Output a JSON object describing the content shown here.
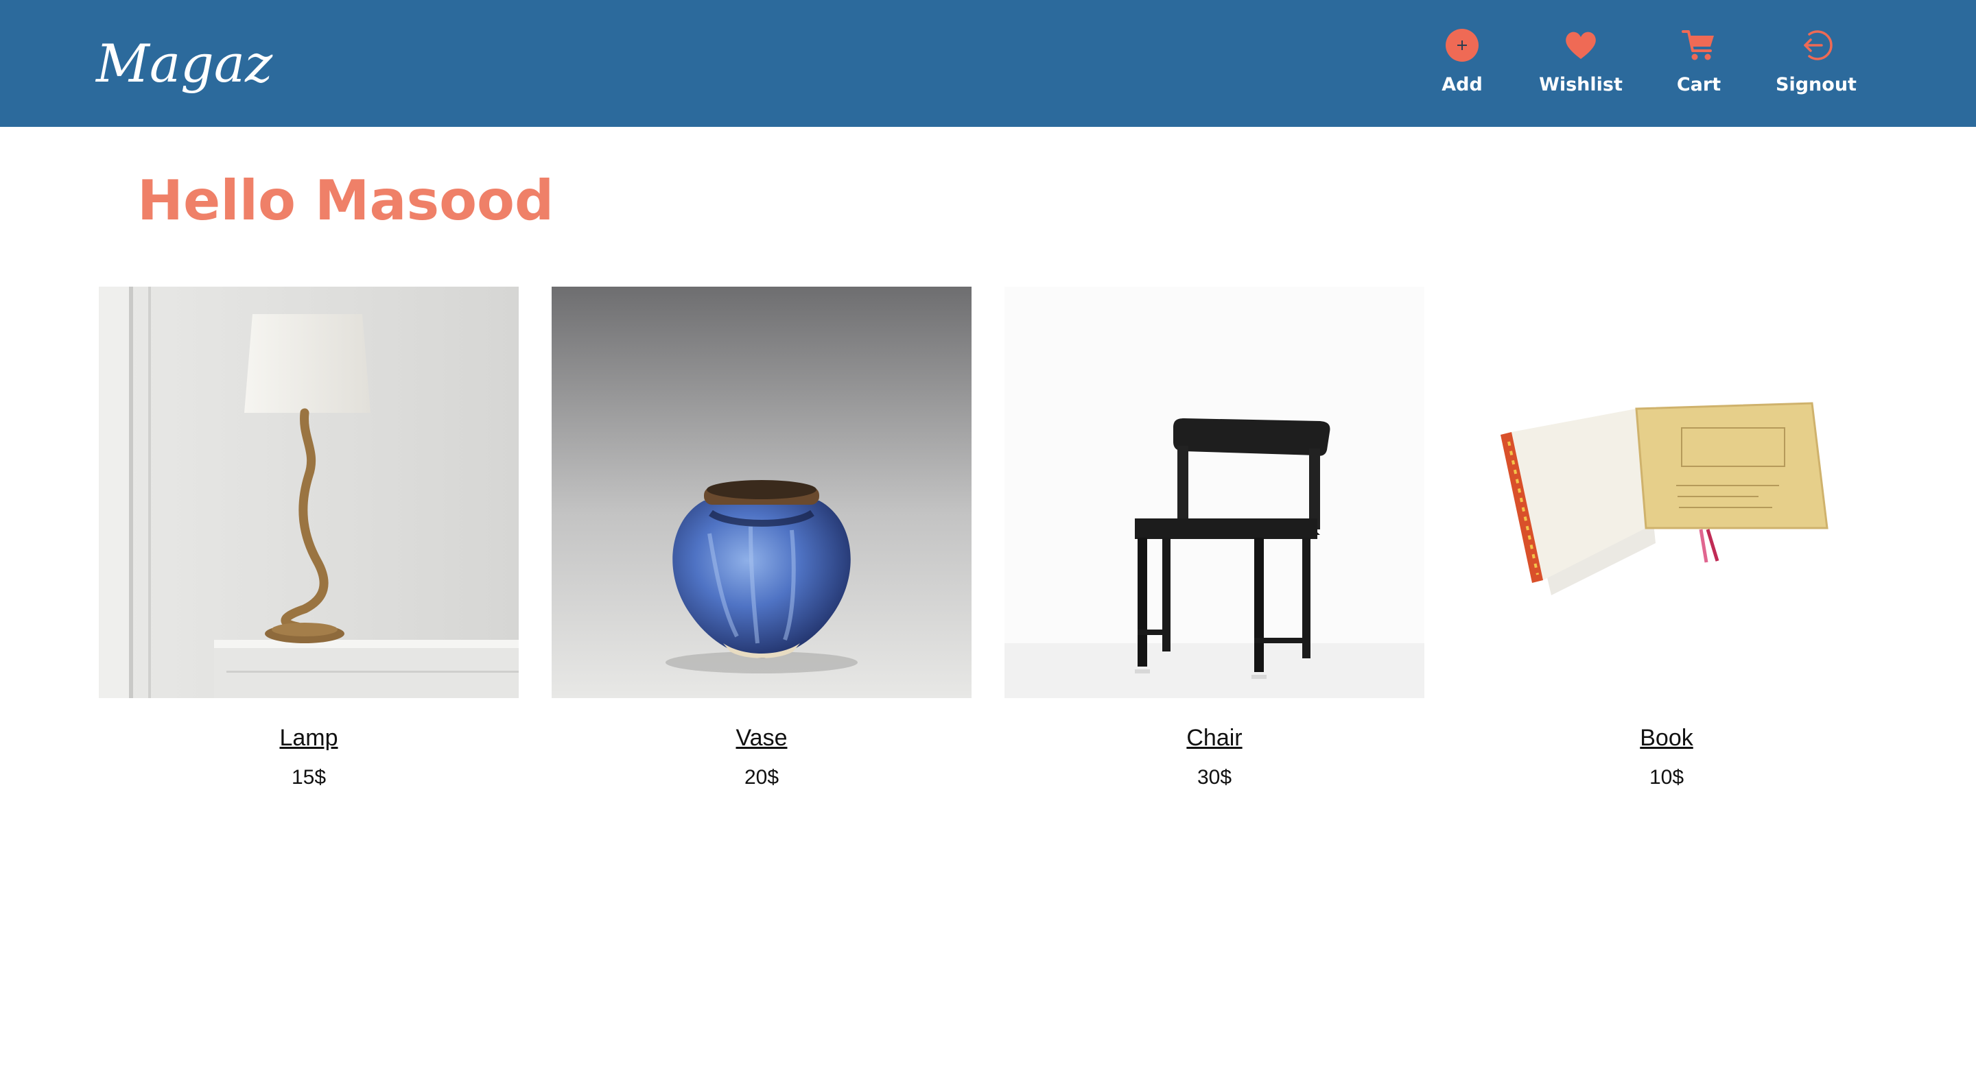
{
  "brand": {
    "logo_text": "Magaz"
  },
  "nav": {
    "items": [
      {
        "label": "Add",
        "icon": "plus-circle-icon"
      },
      {
        "label": "Wishlist",
        "icon": "heart-icon"
      },
      {
        "label": "Cart",
        "icon": "cart-icon"
      },
      {
        "label": "Signout",
        "icon": "signout-icon"
      }
    ]
  },
  "greeting": "Hello Masood",
  "products": [
    {
      "name": "Lamp",
      "price": "15$",
      "image": "lamp-image"
    },
    {
      "name": "Vase",
      "price": "20$",
      "image": "vase-image"
    },
    {
      "name": "Chair",
      "price": "30$",
      "image": "chair-image"
    },
    {
      "name": "Book",
      "price": "10$",
      "image": "book-image"
    }
  ],
  "colors": {
    "navbar": "#2c6a9c",
    "accent": "#ef8068",
    "nav_text": "#ffffff",
    "body_text": "#111111",
    "background": "#ffffff"
  }
}
